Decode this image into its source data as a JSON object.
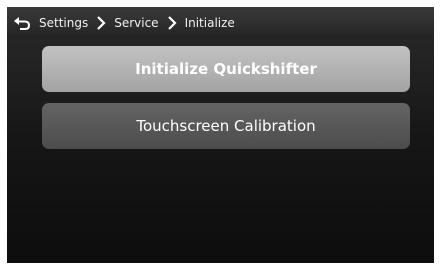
{
  "breadcrumb": {
    "back_icon": "back-arrow-icon",
    "separator_icon": "chevron-right-icon",
    "items": [
      "Settings",
      "Service",
      "Initialize"
    ]
  },
  "menu": {
    "items": [
      {
        "label": "Initialize Quickshifter",
        "state": "highlighted"
      },
      {
        "label": "Touchscreen Calibration",
        "state": "normal"
      }
    ]
  },
  "colors": {
    "background": "#000000",
    "topbar": "#2e2e2e",
    "button_highlight": "#b3b3b3",
    "button_normal": "#585858",
    "text": "#ffffff"
  }
}
